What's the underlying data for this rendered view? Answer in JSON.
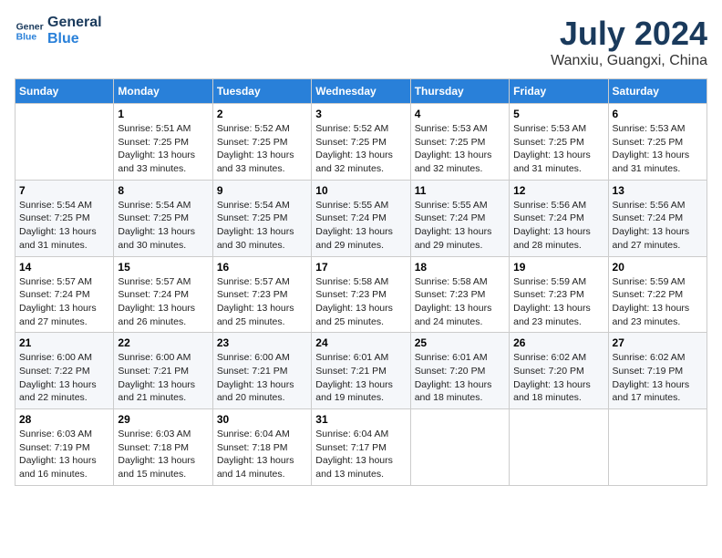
{
  "header": {
    "logo_line1": "General",
    "logo_line2": "Blue",
    "month": "July 2024",
    "location": "Wanxiu, Guangxi, China"
  },
  "weekdays": [
    "Sunday",
    "Monday",
    "Tuesday",
    "Wednesday",
    "Thursday",
    "Friday",
    "Saturday"
  ],
  "weeks": [
    [
      {
        "day": "",
        "sunrise": "",
        "sunset": "",
        "daylight": ""
      },
      {
        "day": "1",
        "sunrise": "Sunrise: 5:51 AM",
        "sunset": "Sunset: 7:25 PM",
        "daylight": "Daylight: 13 hours and 33 minutes."
      },
      {
        "day": "2",
        "sunrise": "Sunrise: 5:52 AM",
        "sunset": "Sunset: 7:25 PM",
        "daylight": "Daylight: 13 hours and 33 minutes."
      },
      {
        "day": "3",
        "sunrise": "Sunrise: 5:52 AM",
        "sunset": "Sunset: 7:25 PM",
        "daylight": "Daylight: 13 hours and 32 minutes."
      },
      {
        "day": "4",
        "sunrise": "Sunrise: 5:53 AM",
        "sunset": "Sunset: 7:25 PM",
        "daylight": "Daylight: 13 hours and 32 minutes."
      },
      {
        "day": "5",
        "sunrise": "Sunrise: 5:53 AM",
        "sunset": "Sunset: 7:25 PM",
        "daylight": "Daylight: 13 hours and 31 minutes."
      },
      {
        "day": "6",
        "sunrise": "Sunrise: 5:53 AM",
        "sunset": "Sunset: 7:25 PM",
        "daylight": "Daylight: 13 hours and 31 minutes."
      }
    ],
    [
      {
        "day": "7",
        "sunrise": "Sunrise: 5:54 AM",
        "sunset": "Sunset: 7:25 PM",
        "daylight": "Daylight: 13 hours and 31 minutes."
      },
      {
        "day": "8",
        "sunrise": "Sunrise: 5:54 AM",
        "sunset": "Sunset: 7:25 PM",
        "daylight": "Daylight: 13 hours and 30 minutes."
      },
      {
        "day": "9",
        "sunrise": "Sunrise: 5:54 AM",
        "sunset": "Sunset: 7:25 PM",
        "daylight": "Daylight: 13 hours and 30 minutes."
      },
      {
        "day": "10",
        "sunrise": "Sunrise: 5:55 AM",
        "sunset": "Sunset: 7:24 PM",
        "daylight": "Daylight: 13 hours and 29 minutes."
      },
      {
        "day": "11",
        "sunrise": "Sunrise: 5:55 AM",
        "sunset": "Sunset: 7:24 PM",
        "daylight": "Daylight: 13 hours and 29 minutes."
      },
      {
        "day": "12",
        "sunrise": "Sunrise: 5:56 AM",
        "sunset": "Sunset: 7:24 PM",
        "daylight": "Daylight: 13 hours and 28 minutes."
      },
      {
        "day": "13",
        "sunrise": "Sunrise: 5:56 AM",
        "sunset": "Sunset: 7:24 PM",
        "daylight": "Daylight: 13 hours and 27 minutes."
      }
    ],
    [
      {
        "day": "14",
        "sunrise": "Sunrise: 5:57 AM",
        "sunset": "Sunset: 7:24 PM",
        "daylight": "Daylight: 13 hours and 27 minutes."
      },
      {
        "day": "15",
        "sunrise": "Sunrise: 5:57 AM",
        "sunset": "Sunset: 7:24 PM",
        "daylight": "Daylight: 13 hours and 26 minutes."
      },
      {
        "day": "16",
        "sunrise": "Sunrise: 5:57 AM",
        "sunset": "Sunset: 7:23 PM",
        "daylight": "Daylight: 13 hours and 25 minutes."
      },
      {
        "day": "17",
        "sunrise": "Sunrise: 5:58 AM",
        "sunset": "Sunset: 7:23 PM",
        "daylight": "Daylight: 13 hours and 25 minutes."
      },
      {
        "day": "18",
        "sunrise": "Sunrise: 5:58 AM",
        "sunset": "Sunset: 7:23 PM",
        "daylight": "Daylight: 13 hours and 24 minutes."
      },
      {
        "day": "19",
        "sunrise": "Sunrise: 5:59 AM",
        "sunset": "Sunset: 7:23 PM",
        "daylight": "Daylight: 13 hours and 23 minutes."
      },
      {
        "day": "20",
        "sunrise": "Sunrise: 5:59 AM",
        "sunset": "Sunset: 7:22 PM",
        "daylight": "Daylight: 13 hours and 23 minutes."
      }
    ],
    [
      {
        "day": "21",
        "sunrise": "Sunrise: 6:00 AM",
        "sunset": "Sunset: 7:22 PM",
        "daylight": "Daylight: 13 hours and 22 minutes."
      },
      {
        "day": "22",
        "sunrise": "Sunrise: 6:00 AM",
        "sunset": "Sunset: 7:21 PM",
        "daylight": "Daylight: 13 hours and 21 minutes."
      },
      {
        "day": "23",
        "sunrise": "Sunrise: 6:00 AM",
        "sunset": "Sunset: 7:21 PM",
        "daylight": "Daylight: 13 hours and 20 minutes."
      },
      {
        "day": "24",
        "sunrise": "Sunrise: 6:01 AM",
        "sunset": "Sunset: 7:21 PM",
        "daylight": "Daylight: 13 hours and 19 minutes."
      },
      {
        "day": "25",
        "sunrise": "Sunrise: 6:01 AM",
        "sunset": "Sunset: 7:20 PM",
        "daylight": "Daylight: 13 hours and 18 minutes."
      },
      {
        "day": "26",
        "sunrise": "Sunrise: 6:02 AM",
        "sunset": "Sunset: 7:20 PM",
        "daylight": "Daylight: 13 hours and 18 minutes."
      },
      {
        "day": "27",
        "sunrise": "Sunrise: 6:02 AM",
        "sunset": "Sunset: 7:19 PM",
        "daylight": "Daylight: 13 hours and 17 minutes."
      }
    ],
    [
      {
        "day": "28",
        "sunrise": "Sunrise: 6:03 AM",
        "sunset": "Sunset: 7:19 PM",
        "daylight": "Daylight: 13 hours and 16 minutes."
      },
      {
        "day": "29",
        "sunrise": "Sunrise: 6:03 AM",
        "sunset": "Sunset: 7:18 PM",
        "daylight": "Daylight: 13 hours and 15 minutes."
      },
      {
        "day": "30",
        "sunrise": "Sunrise: 6:04 AM",
        "sunset": "Sunset: 7:18 PM",
        "daylight": "Daylight: 13 hours and 14 minutes."
      },
      {
        "day": "31",
        "sunrise": "Sunrise: 6:04 AM",
        "sunset": "Sunset: 7:17 PM",
        "daylight": "Daylight: 13 hours and 13 minutes."
      },
      {
        "day": "",
        "sunrise": "",
        "sunset": "",
        "daylight": ""
      },
      {
        "day": "",
        "sunrise": "",
        "sunset": "",
        "daylight": ""
      },
      {
        "day": "",
        "sunrise": "",
        "sunset": "",
        "daylight": ""
      }
    ]
  ]
}
